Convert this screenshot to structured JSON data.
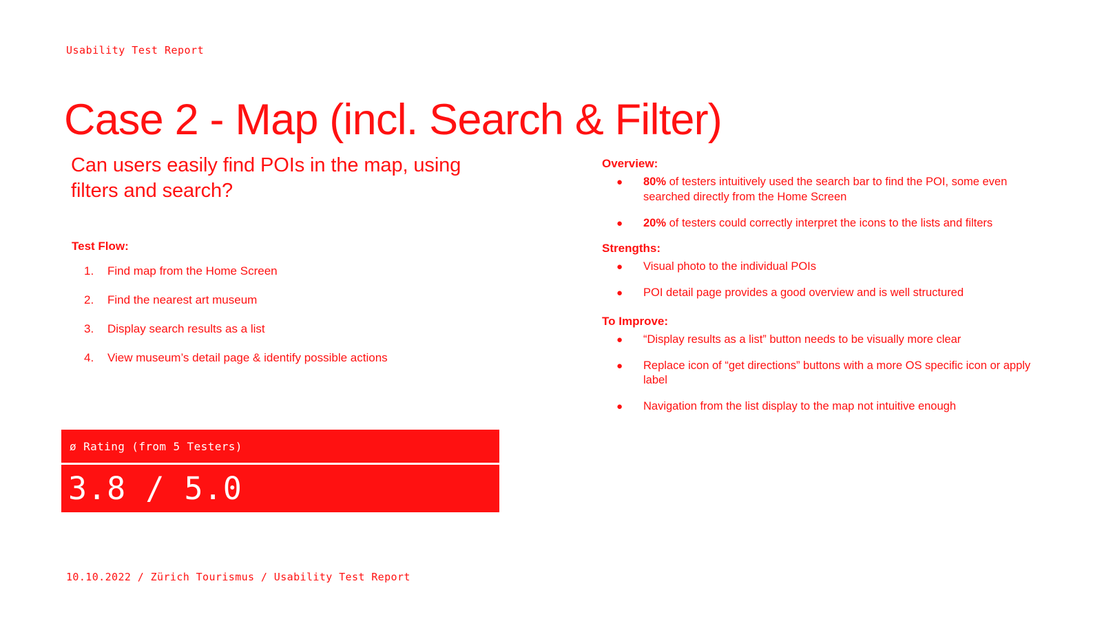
{
  "header": {
    "kicker": "Usability Test Report",
    "title": "Case 2 - Map (incl. Search & Filter)"
  },
  "left": {
    "research_question": "Can users easily find POIs in the map, using filters and search?",
    "test_flow_label": "Test Flow:",
    "test_flow_steps": [
      {
        "num": "1.",
        "text": "Find map from the Home Screen"
      },
      {
        "num": "2.",
        "text": "Find the nearest art museum"
      },
      {
        "num": "3.",
        "text": "Display search results as a list"
      },
      {
        "num": "4.",
        "text": "View museum’s detail page & identify possible actions"
      }
    ]
  },
  "rating": {
    "label": "ø Rating (from 5 Testers)",
    "value": "3.8 / 5.0"
  },
  "right": {
    "overview_label": "Overview:",
    "overview_items": [
      {
        "bullet": "●",
        "bold": "80%",
        "text": " of testers intuitively used the search bar to find the POI, some even searched directly from the Home Screen"
      },
      {
        "bullet": "●",
        "bold": "20%",
        "text": " of testers could correctly interpret the icons to the lists and filters"
      }
    ],
    "strengths_label": "Strengths:",
    "strengths_items": [
      {
        "bullet": "●",
        "text": "Visual photo to the individual POIs"
      },
      {
        "bullet": "●",
        "text": " POI detail page provides a good overview and is well structured"
      }
    ],
    "improve_label": "To Improve:",
    "improve_items": [
      {
        "bullet": "●",
        "text": "“Display results as a list” button needs to be visually more clear"
      },
      {
        "bullet": "●",
        "text": "Replace icon of “get directions” buttons with a more OS specific icon or apply label"
      },
      {
        "bullet": "●",
        "text": "Navigation from the list display to the map not intuitive enough"
      }
    ]
  },
  "footer": {
    "text": "10.10.2022 / Zürich Tourismus / Usability Test Report"
  },
  "colors": {
    "accent": "#FF1111",
    "background": "#FFFFFF",
    "on_accent": "#FFFFFF"
  }
}
